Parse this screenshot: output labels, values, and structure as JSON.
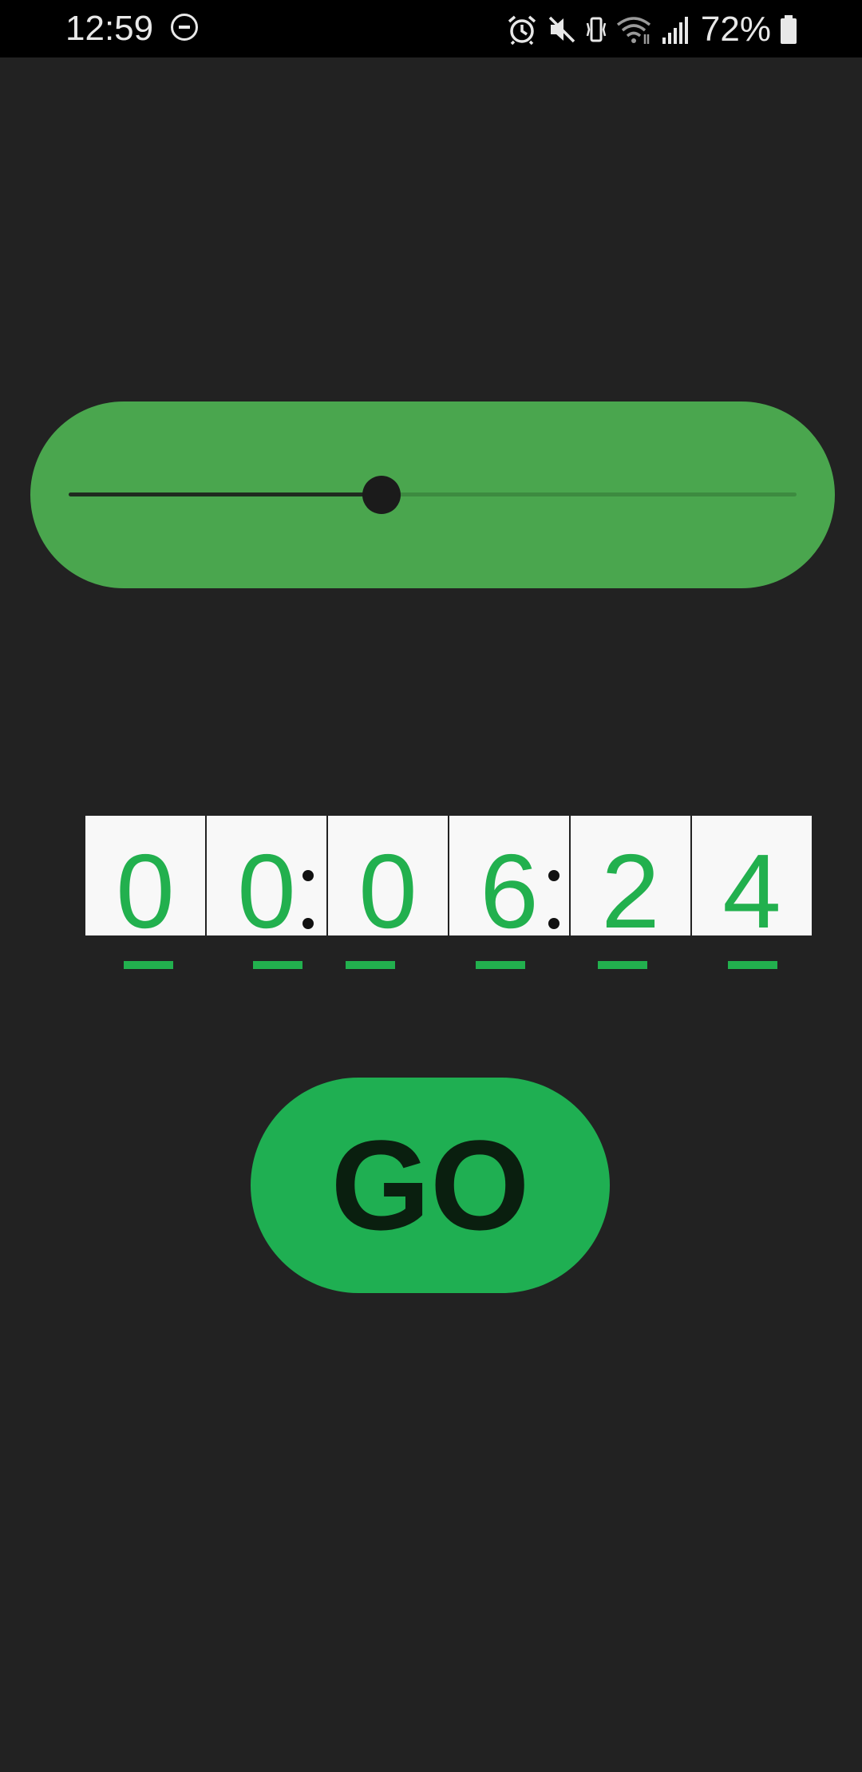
{
  "status_bar": {
    "time": "12:59",
    "battery": "72%",
    "icons": [
      "do-not-disturb-icon",
      "alarm-icon",
      "mute-icon",
      "vibrate-icon",
      "wifi-icon",
      "signal-icon",
      "battery-icon"
    ]
  },
  "slider": {
    "value_fraction": 0.43
  },
  "timer": {
    "digits": [
      "0",
      "0",
      "0",
      "6",
      "2",
      "4"
    ]
  },
  "go_button": {
    "label": "GO"
  },
  "colors": {
    "background": "#222222",
    "slider_pill": "#4aa64e",
    "accent_green": "#1faf52",
    "digit_green": "#22b04e",
    "go_text": "#0a1f0f"
  }
}
